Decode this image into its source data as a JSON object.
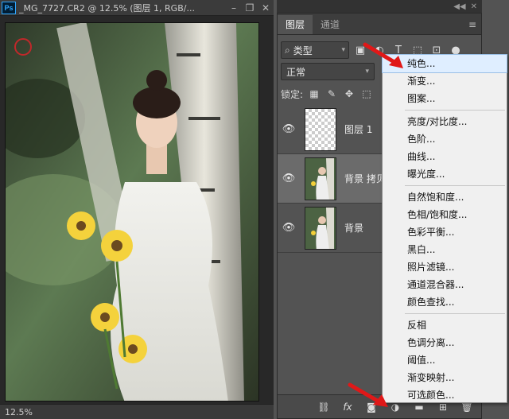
{
  "document": {
    "app_badge": "Ps",
    "title": "_MG_7727.CR2 @ 12.5% (图层 1, RGB/...",
    "minimize_label": "–",
    "restore_label": "❐",
    "close_label": "✕",
    "zoom_status": "12.5%"
  },
  "panel": {
    "collapse_labels": [
      "◀◀",
      "✕"
    ],
    "tabs": [
      {
        "label": "图层",
        "active": true
      },
      {
        "label": "通道",
        "active": false
      }
    ],
    "menu_icon": "≡",
    "filter": {
      "search_glyph": "⌕",
      "label": "类型",
      "chevron": "▾"
    },
    "filter_icons": [
      {
        "name": "image-filter-icon",
        "glyph": "▣"
      },
      {
        "name": "adjustment-filter-icon",
        "glyph": "◐"
      },
      {
        "name": "text-filter-icon",
        "glyph": "T"
      },
      {
        "name": "shape-filter-icon",
        "glyph": "⬚"
      },
      {
        "name": "smart-object-filter-icon",
        "glyph": "⊡"
      },
      {
        "name": "filter-toggle-icon",
        "glyph": "●"
      }
    ],
    "blend_mode": {
      "value": "正常",
      "chevron": "▾"
    },
    "lock": {
      "label": "锁定:",
      "icons": [
        {
          "name": "lock-transparent-icon",
          "glyph": "▦"
        },
        {
          "name": "lock-image-icon",
          "glyph": "✎"
        },
        {
          "name": "lock-position-icon",
          "glyph": "✥"
        },
        {
          "name": "lock-artboard-icon",
          "glyph": "⬚"
        }
      ]
    },
    "layers": [
      {
        "name": "图层 1",
        "visible_glyph": "👁",
        "thumb": "transparent",
        "selected": false
      },
      {
        "name": "背景 拷贝",
        "visible_glyph": "👁",
        "thumb": "photo",
        "selected": true
      },
      {
        "name": "背景",
        "visible_glyph": "👁",
        "thumb": "photo",
        "selected": false
      }
    ],
    "bottom_icons": [
      {
        "name": "link-layers-icon",
        "glyph": "⛓"
      },
      {
        "name": "layer-style-fx-icon",
        "glyph": "fx"
      },
      {
        "name": "add-mask-icon",
        "glyph": "◙"
      },
      {
        "name": "new-adjustment-layer-icon",
        "glyph": "◑"
      },
      {
        "name": "new-group-icon",
        "glyph": "▬"
      },
      {
        "name": "new-layer-icon",
        "glyph": "⊞"
      },
      {
        "name": "delete-layer-icon",
        "glyph": "🗑"
      }
    ]
  },
  "adjustment_menu": {
    "groups": [
      [
        "纯色...",
        "渐变...",
        "图案..."
      ],
      [
        "亮度/对比度...",
        "色阶...",
        "曲线...",
        "曝光度..."
      ],
      [
        "自然饱和度...",
        "色相/饱和度...",
        "色彩平衡...",
        "黑白...",
        "照片滤镜...",
        "通道混合器...",
        "颜色查找..."
      ],
      [
        "反相",
        "色调分离...",
        "阈值...",
        "渐变映射...",
        "可选颜色..."
      ]
    ],
    "hover_item": "纯色..."
  },
  "colors": {
    "annotation_arrow": "#e01818",
    "ps_badge": "#31a8ff"
  }
}
